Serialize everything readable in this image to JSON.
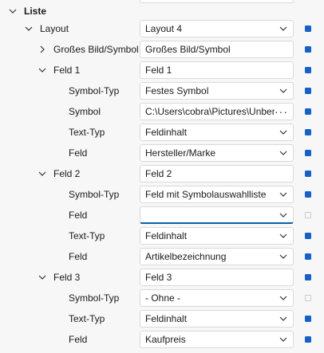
{
  "colors": {
    "accent": "#1660c9",
    "active_underline": "#0a5ea8"
  },
  "rows": [
    {
      "label": "Liste",
      "value": ""
    },
    {
      "label": "Layout",
      "value": "Layout 4"
    },
    {
      "label": "Großes Bild/Symbol",
      "value": "Großes Bild/Symbol"
    },
    {
      "label": "Feld 1",
      "value": "Feld 1"
    },
    {
      "label": "Symbol-Typ",
      "value": "Festes Symbol"
    },
    {
      "label": "Symbol",
      "value": "C:\\Users\\cobra\\Pictures\\Unben..."
    },
    {
      "label": "Text-Typ",
      "value": "Feldinhalt"
    },
    {
      "label": "Feld",
      "value": "Hersteller/Marke"
    },
    {
      "label": "Feld 2",
      "value": "Feld 2"
    },
    {
      "label": "Symbol-Typ",
      "value": "Feld mit Symbolauswahlliste"
    },
    {
      "label": "Feld",
      "value": ""
    },
    {
      "label": "Text-Typ",
      "value": "Feldinhalt"
    },
    {
      "label": "Feld",
      "value": "Artikelbezeichnung"
    },
    {
      "label": "Feld 3",
      "value": "Feld 3"
    },
    {
      "label": "Symbol-Typ",
      "value": "- Ohne -"
    },
    {
      "label": "Text-Typ",
      "value": "Feldinhalt"
    },
    {
      "label": "Feld",
      "value": "Kaufpreis"
    }
  ]
}
